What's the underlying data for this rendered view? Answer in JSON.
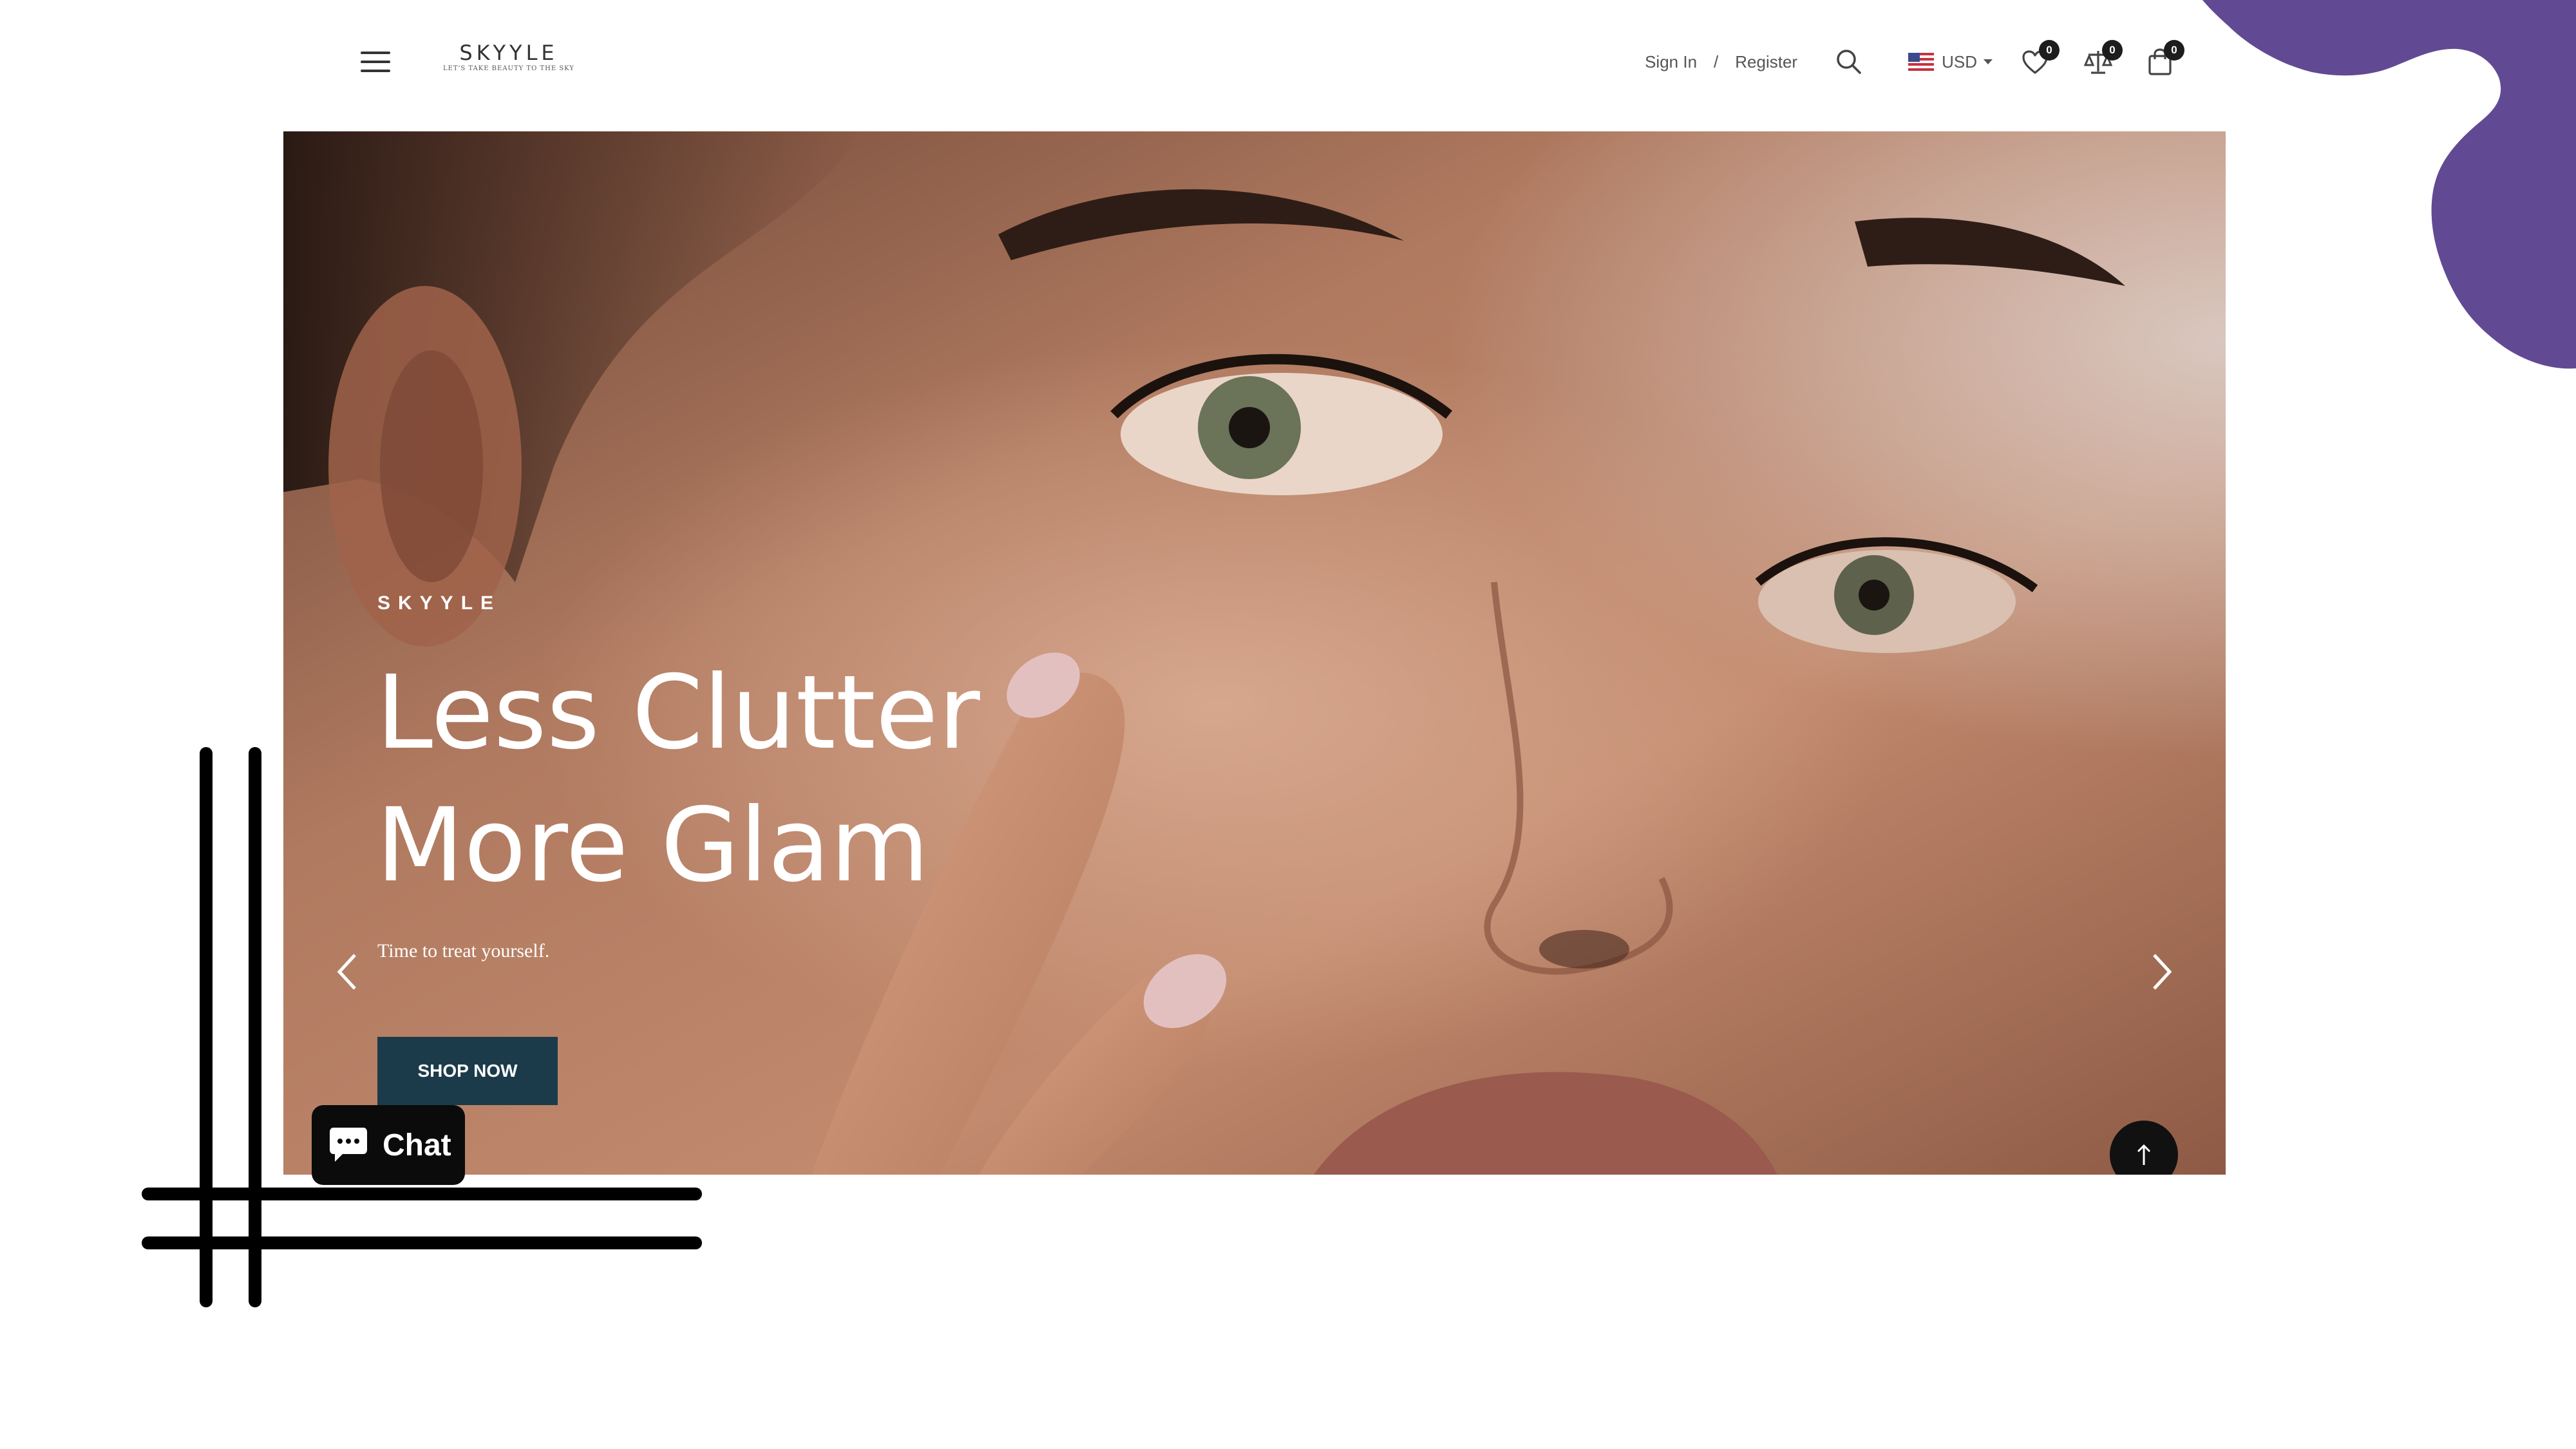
{
  "header": {
    "logo_name": "SKYYLE",
    "logo_tagline": "LET'S TAKE BEAUTY TO THE SKY",
    "sign_in_label": "Sign In",
    "separator": "/",
    "register_label": "Register",
    "currency_label": "USD",
    "wishlist_count": "0",
    "compare_count": "0",
    "cart_count": "0",
    "icons": {
      "menu": "hamburger-menu-icon",
      "search": "search-icon",
      "flag": "us-flag-icon",
      "wishlist": "heart-icon",
      "compare": "scale-compare-icon",
      "cart": "shopping-bag-icon"
    }
  },
  "hero": {
    "eyebrow": "SKYYLE",
    "title_line1": "Less Clutter",
    "title_line2": "More Glam",
    "subtitle": "Time to treat yourself.",
    "cta_label": "SHOP NOW",
    "icons": {
      "prev": "chevron-left-icon",
      "next": "chevron-right-icon",
      "back_to_top": "arrow-up-icon"
    }
  },
  "chat": {
    "label": "Chat",
    "icon": "chat-bubble-icon"
  },
  "colors": {
    "cta_background": "#1c3b4a",
    "blob": "#614a93",
    "badge": "#1d1d1d",
    "chat_background": "#0b0b0b"
  }
}
